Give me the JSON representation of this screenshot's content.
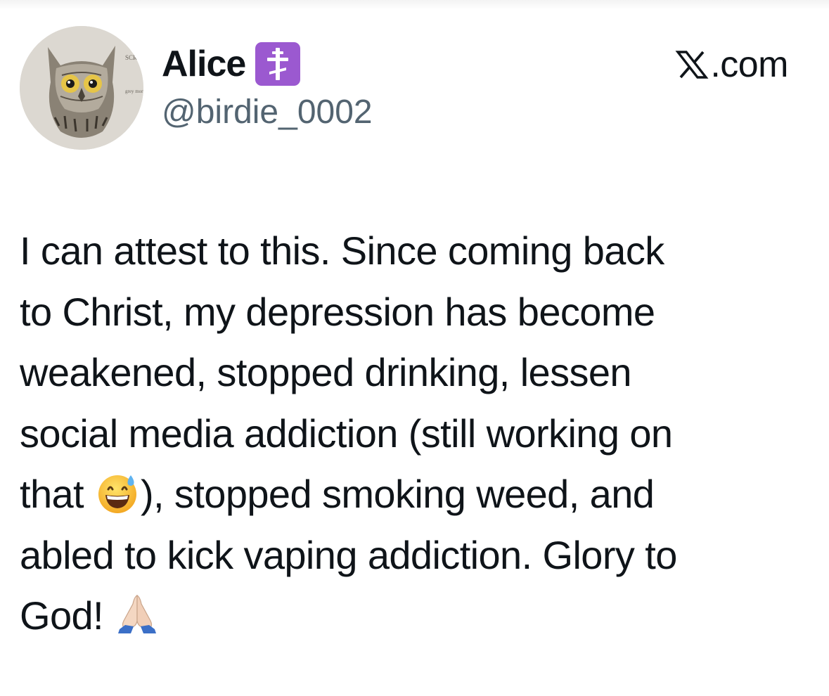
{
  "post": {
    "author": {
      "display_name": "Alice",
      "handle": "@birdie_0002",
      "badge_icon": "orthodox-cross-icon",
      "avatar_icon": "owl-avatar",
      "avatar_labels": [
        "SCR",
        "grey morph"
      ]
    },
    "watermark": {
      "icon": "x-logo-icon",
      "text": ".com"
    },
    "body_lines": [
      {
        "text": "I can attest to this. Since coming back"
      },
      {
        "text": "to Christ, my depression has become"
      },
      {
        "text": "weakened, stopped drinking, lessen"
      },
      {
        "text": "social media addiction (still working on"
      },
      {
        "before": "that ",
        "emoji": "grinning-face-with-sweat-emoji",
        "after": "), stopped smoking weed, and"
      },
      {
        "text": "abled to kick vaping addiction. Glory to"
      },
      {
        "before": "God! ",
        "emoji": "folded-hands-emoji"
      }
    ]
  },
  "colors": {
    "text": "#0f1419",
    "secondary_text": "#536471",
    "badge_bg": "#9b59d0",
    "background": "#ffffff"
  }
}
